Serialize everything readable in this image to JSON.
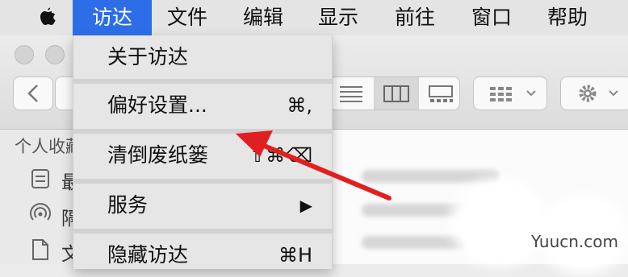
{
  "menubar": {
    "apple_icon": "apple-icon",
    "items": [
      {
        "label": "访达",
        "active": true
      },
      {
        "label": "文件"
      },
      {
        "label": "编辑"
      },
      {
        "label": "显示"
      },
      {
        "label": "前往"
      },
      {
        "label": "窗口"
      },
      {
        "label": "帮助"
      }
    ]
  },
  "finder_menu": {
    "items": [
      {
        "label": "关于访达",
        "shortcut": ""
      },
      {
        "label": "偏好设置...",
        "shortcut": "⌘,"
      },
      {
        "label": "清倒废纸篓",
        "shortcut": "⇧⌘⌫"
      },
      {
        "label": "服务",
        "shortcut": "▶"
      },
      {
        "label": "隐藏访达",
        "shortcut": "⌘H"
      }
    ]
  },
  "sidebar": {
    "heading": "个人收藏",
    "items": [
      {
        "label": "最",
        "icon": "recents-icon"
      },
      {
        "label": "隔",
        "icon": "airdrop-icon"
      },
      {
        "label": "文",
        "icon": "documents-icon"
      }
    ]
  },
  "watermark": "Yuucn.com",
  "accent_color": "#2d6ee8",
  "annotation_color": "#e02020"
}
